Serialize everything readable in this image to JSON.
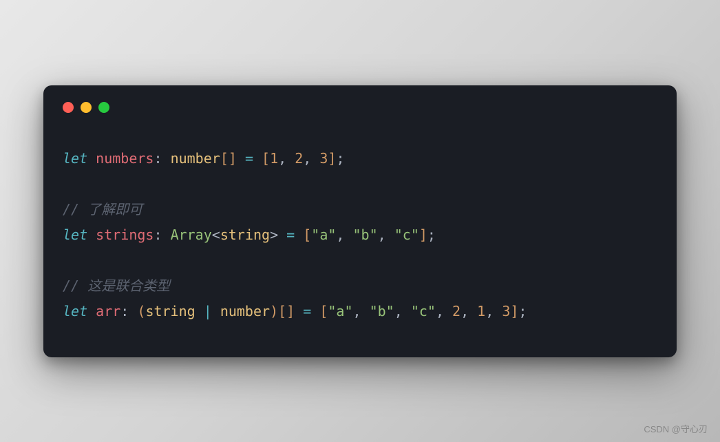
{
  "code": {
    "line1": {
      "let": "let",
      "var": "numbers",
      "colon": ": ",
      "type": "number",
      "brackets": "[]",
      "eq": " = ",
      "open": "[",
      "n1": "1",
      "c1": ", ",
      "n2": "2",
      "c2": ", ",
      "n3": "3",
      "close": "]",
      "semi": ";"
    },
    "comment1": "// 了解即可",
    "line2": {
      "let": "let",
      "var": "strings",
      "colon": ": ",
      "arrayType": "Array",
      "lt": "<",
      "innerType": "string",
      "gt": ">",
      "eq": " = ",
      "open": "[",
      "s1": "\"a\"",
      "c1": ", ",
      "s2": "\"b\"",
      "c2": ", ",
      "s3": "\"c\"",
      "close": "]",
      "semi": ";"
    },
    "comment2": "// 这是联合类型",
    "line3": {
      "let": "let",
      "var": "arr",
      "colon": ": ",
      "popen": "(",
      "t1": "string",
      "pipe": " | ",
      "t2": "number",
      "pclose": ")",
      "brackets": "[]",
      "eq": " = ",
      "open": "[",
      "s1": "\"a\"",
      "c1": ", ",
      "s2": "\"b\"",
      "c2": ", ",
      "s3": "\"c\"",
      "c3": ", ",
      "n1": "2",
      "c4": ", ",
      "n2": "1",
      "c5": ", ",
      "n3": "3",
      "close": "]",
      "semi": ";"
    }
  },
  "watermark": "CSDN @守心刃"
}
